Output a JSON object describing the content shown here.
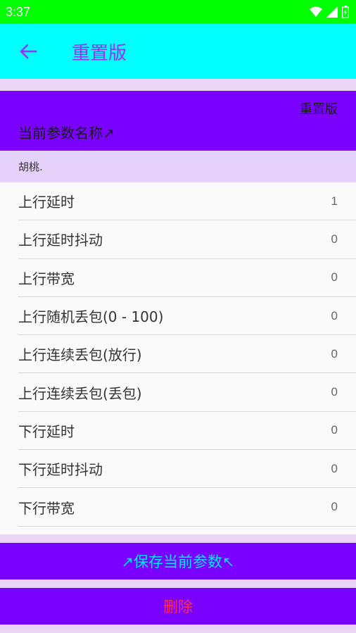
{
  "status_bar": {
    "time": "3:37",
    "icons": [
      "wifi-icon",
      "signal-icon",
      "battery-icon"
    ]
  },
  "app_bar": {
    "title": "重置版",
    "back_icon": "arrow-left-icon"
  },
  "profile": {
    "name": "重置版",
    "param_label": "当前参数名称↗"
  },
  "section": {
    "header": "胡桃."
  },
  "params": [
    {
      "label": "上行延时",
      "value": "1"
    },
    {
      "label": "上行延时抖动",
      "value": "0"
    },
    {
      "label": "上行带宽",
      "value": "0"
    },
    {
      "label": "上行随机丢包(0 - 100)",
      "value": "0"
    },
    {
      "label": "上行连续丢包(放行)",
      "value": "0"
    },
    {
      "label": "上行连续丢包(丢包)",
      "value": "0"
    },
    {
      "label": "下行延时",
      "value": "0"
    },
    {
      "label": "下行延时抖动",
      "value": "0"
    },
    {
      "label": "下行带宽",
      "value": "0"
    }
  ],
  "actions": {
    "save_label": "↗保存当前参数↖",
    "delete_label": "删除"
  },
  "colors": {
    "status_bar": "#00ff00",
    "app_bar": "#00ffff",
    "accent": "#9b30ff",
    "card": "#7a00ff",
    "save_text": "#00e5ff",
    "delete_text": "#ff2d55"
  }
}
